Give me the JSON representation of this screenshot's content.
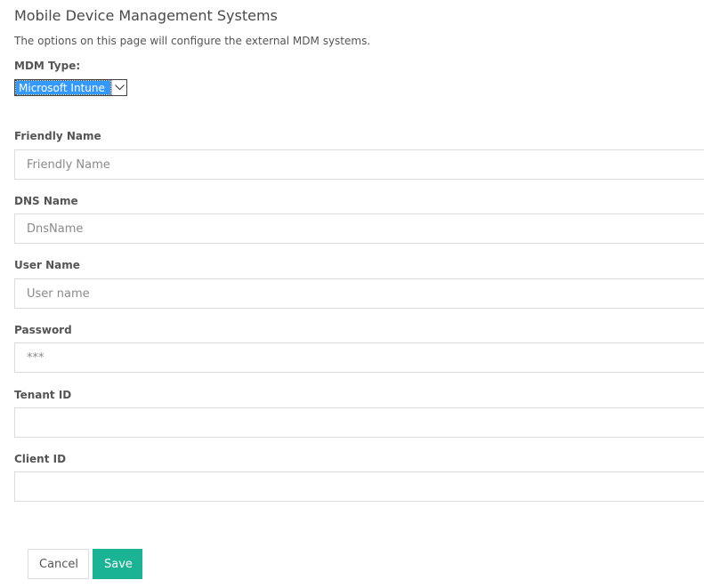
{
  "header": {
    "title": "Mobile Device Management Systems",
    "description": "The options on this page will configure the external MDM systems."
  },
  "mdm_type": {
    "label": "MDM Type:",
    "selected": "Microsoft Intune"
  },
  "fields": [
    {
      "label": "Friendly Name",
      "placeholder": "Friendly Name",
      "value": ""
    },
    {
      "label": "DNS Name",
      "placeholder": "DnsName",
      "value": ""
    },
    {
      "label": "User Name",
      "placeholder": "User name",
      "value": ""
    },
    {
      "label": "Password",
      "placeholder": "***",
      "value": ""
    },
    {
      "label": "Tenant ID",
      "placeholder": "",
      "value": ""
    },
    {
      "label": "Client ID",
      "placeholder": "",
      "value": ""
    }
  ],
  "actions": {
    "cancel_label": "Cancel",
    "save_label": "Save",
    "save_color": "#1ab394"
  },
  "icons": {
    "dropdown": "chevron-down-icon"
  }
}
